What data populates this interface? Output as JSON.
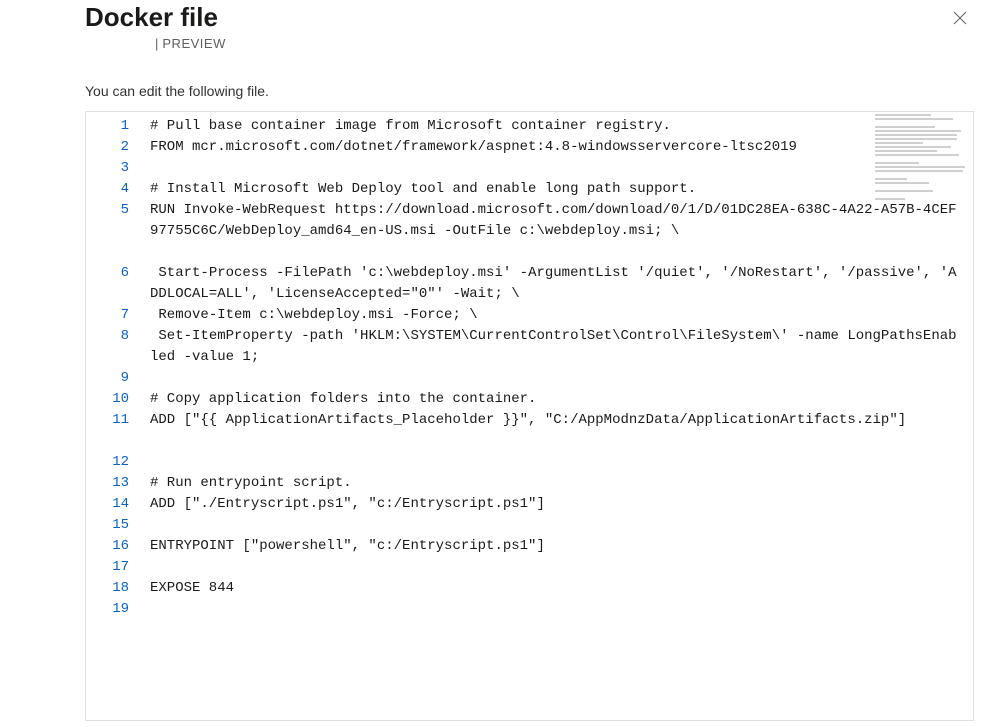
{
  "header": {
    "title": "Docker file",
    "badge": "PREVIEW",
    "pipe": "|"
  },
  "subtitle": "You can edit the following file.",
  "code": {
    "rows": [
      {
        "n": 1,
        "text": "# Pull base container image from Microsoft container registry.",
        "h": 1
      },
      {
        "n": 2,
        "text": "FROM mcr.microsoft.com/dotnet/framework/aspnet:4.8-windowsservercore-ltsc2019",
        "h": 1
      },
      {
        "n": 3,
        "text": "",
        "h": 1
      },
      {
        "n": 4,
        "text": "# Install Microsoft Web Deploy tool and enable long path support.",
        "h": 1
      },
      {
        "n": 5,
        "text": "RUN Invoke-WebRequest https://download.microsoft.com/download/0/1/D/01DC28EA-638C-4A22-A57B-4CEF97755C6C/WebDeploy_amd64_en-US.msi -OutFile c:\\webdeploy.msi; \\",
        "h": 3
      },
      {
        "n": 6,
        "text": " Start-Process -FilePath 'c:\\webdeploy.msi' -ArgumentList '/quiet', '/NoRestart', '/passive', 'ADDLOCAL=ALL', 'LicenseAccepted=\"0\"' -Wait; \\",
        "h": 2
      },
      {
        "n": 7,
        "text": " Remove-Item c:\\webdeploy.msi -Force; \\",
        "h": 1
      },
      {
        "n": 8,
        "text": " Set-ItemProperty -path 'HKLM:\\SYSTEM\\CurrentControlSet\\Control\\FileSystem\\' -name LongPathsEnabled -value 1;",
        "h": 2
      },
      {
        "n": 9,
        "text": "",
        "h": 1
      },
      {
        "n": 10,
        "text": "# Copy application folders into the container.",
        "h": 1
      },
      {
        "n": 11,
        "text": "ADD [\"{{ ApplicationArtifacts_Placeholder }}\", \"C:/AppModnzData/ApplicationArtifacts.zip\"]",
        "h": 2
      },
      {
        "n": 12,
        "text": "",
        "h": 1
      },
      {
        "n": 13,
        "text": "# Run entrypoint script.",
        "h": 1
      },
      {
        "n": 14,
        "text": "ADD [\"./Entryscript.ps1\", \"c:/Entryscript.ps1\"]",
        "h": 1
      },
      {
        "n": 15,
        "text": "",
        "h": 1
      },
      {
        "n": 16,
        "text": "ENTRYPOINT [\"powershell\", \"c:/Entryscript.ps1\"]",
        "h": 1
      },
      {
        "n": 17,
        "text": "",
        "h": 1
      },
      {
        "n": 18,
        "text": "EXPOSE 844",
        "h": 1
      },
      {
        "n": 19,
        "text": "",
        "h": 1
      }
    ]
  },
  "minimap_widths": [
    56,
    78,
    0,
    60,
    86,
    82,
    82,
    48,
    76,
    62,
    84,
    0,
    44,
    90,
    88,
    0,
    32,
    54,
    0,
    58,
    0,
    30,
    0
  ],
  "icons": {
    "close": "close-icon"
  }
}
